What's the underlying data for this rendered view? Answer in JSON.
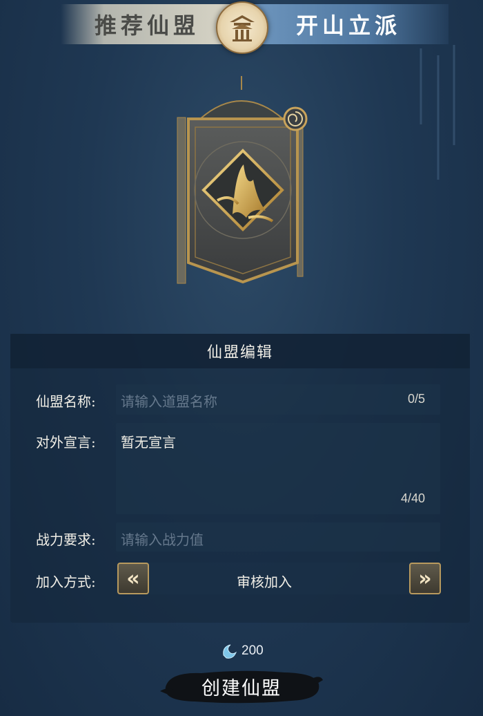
{
  "tabs": {
    "recommended": "推荐仙盟",
    "create": "开山立派"
  },
  "editor": {
    "title": "仙盟编辑",
    "name_label": "仙盟名称:",
    "name_placeholder": "请输入道盟名称",
    "name_counter": "0/5",
    "declaration_label": "对外宣言:",
    "declaration_value": "暂无宣言",
    "declaration_counter": "4/40",
    "power_label": "战力要求:",
    "power_placeholder": "请输入战力值",
    "join_label": "加入方式:",
    "join_value": "审核加入"
  },
  "cost": {
    "amount": "200",
    "icon": "jade-currency-icon"
  },
  "create_button": "创建仙盟",
  "colors": {
    "accent_gold": "#c9a45c",
    "tab_active": "#4f77a0",
    "background": "#1f3853"
  }
}
